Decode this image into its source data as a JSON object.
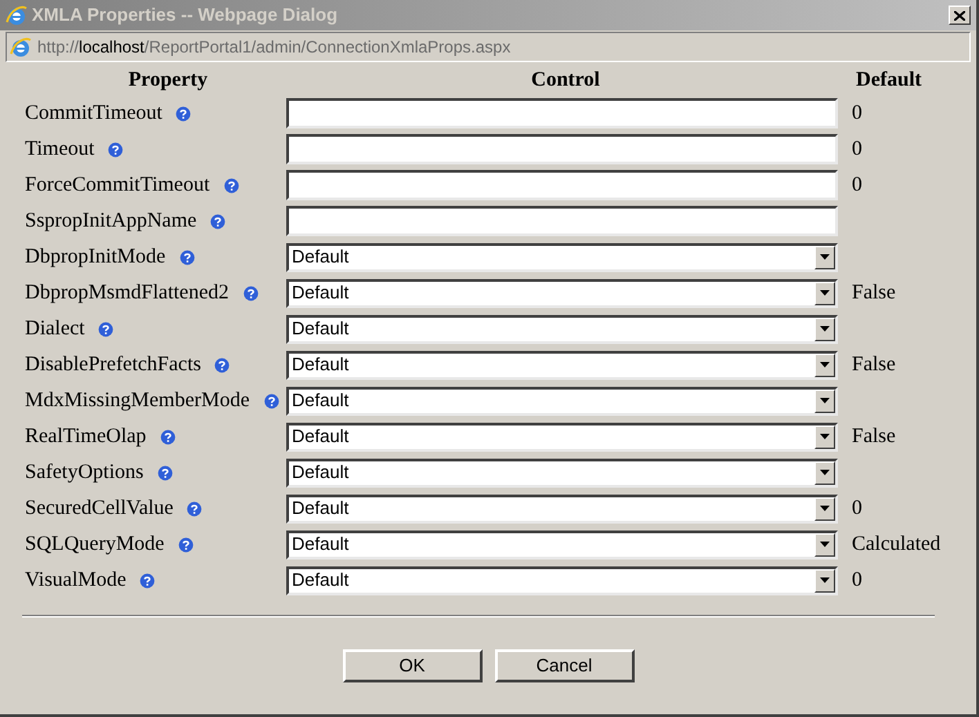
{
  "window": {
    "title": "XMLA Properties -- Webpage Dialog"
  },
  "address_bar": {
    "scheme": "http://",
    "host": "localhost",
    "path": "/ReportPortal1/admin/ConnectionXmlaProps.aspx"
  },
  "table": {
    "columns": [
      "Property",
      "Control",
      "Default"
    ],
    "rows": [
      {
        "property": "CommitTimeout",
        "kind": "text",
        "value": "",
        "default": "0"
      },
      {
        "property": "Timeout",
        "kind": "text",
        "value": "",
        "default": "0"
      },
      {
        "property": "ForceCommitTimeout",
        "kind": "text",
        "value": "",
        "default": "0"
      },
      {
        "property": "SspropInitAppName",
        "kind": "text",
        "value": "",
        "default": ""
      },
      {
        "property": "DbpropInitMode",
        "kind": "select",
        "value": "Default",
        "default": ""
      },
      {
        "property": "DbpropMsmdFlattened2",
        "kind": "select",
        "value": "Default",
        "default": "False"
      },
      {
        "property": "Dialect",
        "kind": "select",
        "value": "Default",
        "default": ""
      },
      {
        "property": "DisablePrefetchFacts",
        "kind": "select",
        "value": "Default",
        "default": "False"
      },
      {
        "property": "MdxMissingMemberMode",
        "kind": "select",
        "value": "Default",
        "default": ""
      },
      {
        "property": "RealTimeOlap",
        "kind": "select",
        "value": "Default",
        "default": "False"
      },
      {
        "property": "SafetyOptions",
        "kind": "select",
        "value": "Default",
        "default": ""
      },
      {
        "property": "SecuredCellValue",
        "kind": "select",
        "value": "Default",
        "default": "0"
      },
      {
        "property": "SQLQueryMode",
        "kind": "select",
        "value": "Default",
        "default": "Calculated"
      },
      {
        "property": "VisualMode",
        "kind": "select",
        "value": "Default",
        "default": "0"
      }
    ]
  },
  "buttons": [
    "OK",
    "Cancel"
  ]
}
